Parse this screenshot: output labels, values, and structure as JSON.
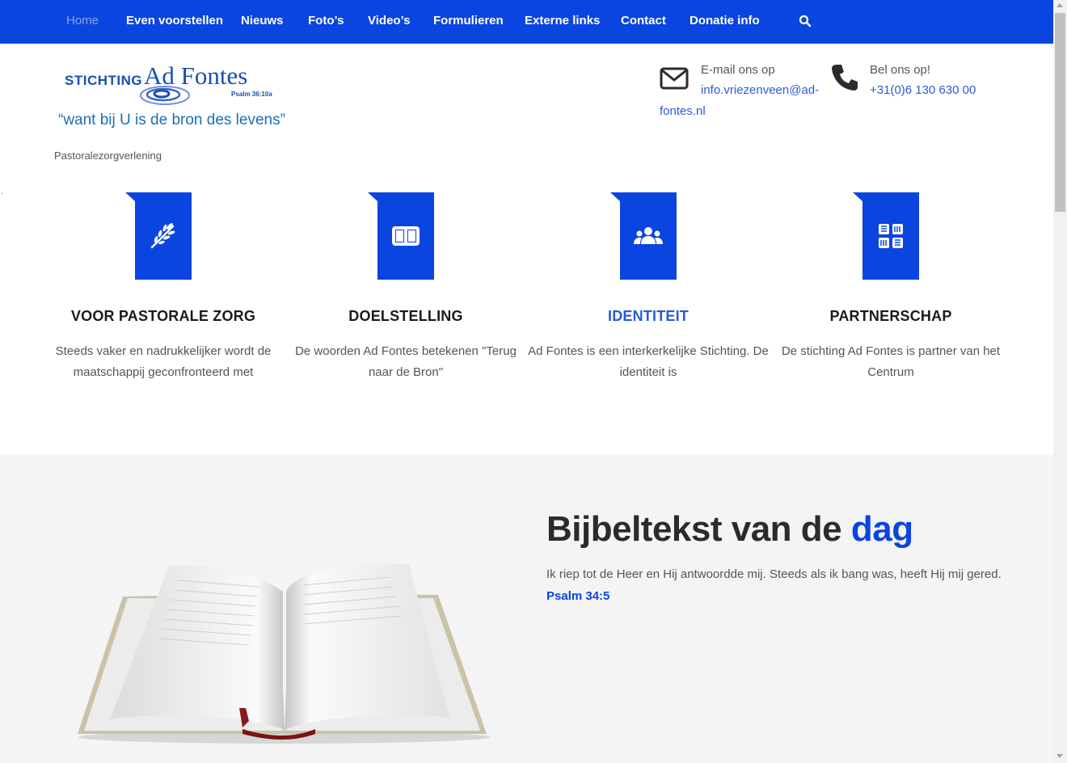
{
  "nav": {
    "items": [
      {
        "label": "Home",
        "active": true
      },
      {
        "label": "Even voorstellen"
      },
      {
        "label": "Nieuws"
      },
      {
        "label": "Foto’s"
      },
      {
        "label": "Video’s"
      },
      {
        "label": "Formulieren"
      },
      {
        "label": "Externe links"
      },
      {
        "label": "Contact"
      },
      {
        "label": "Donatie info"
      }
    ],
    "search_icon": "search-icon"
  },
  "logo": {
    "stichting": "STICHTING",
    "name": "Ad Fontes",
    "psalm": "Psalm 36:10a",
    "motto": "“want bij U is de bron des levens”"
  },
  "tagline": "Pastoralezorgverlening",
  "stray_dot": ".",
  "contact": {
    "email_label": "E-mail ons op",
    "email_value": "info.vriezenveen@ad-fontes.nl",
    "phone_label": "Bel ons op!",
    "phone_value": "+31(0)6 130 630 00"
  },
  "features": [
    {
      "icon": "olive-branch-icon",
      "title": "VOOR PASTORALE ZORG",
      "text": "Steeds vaker en nadrukkelijker wordt de maatschappij geconfronteerd met"
    },
    {
      "icon": "open-book-icon",
      "title": "DOELSTELLING",
      "text": "De woorden Ad Fontes betekenen \"Terug naar de Bron\""
    },
    {
      "icon": "people-group-icon",
      "title": "IDENTITEIT",
      "text": "Ad Fontes is een interkerkelijke Stichting. De identiteit is"
    },
    {
      "icon": "hands-together-icon",
      "title": "PARTNERSCHAP",
      "text": "De stichting Ad Fontes is partner van het Centrum"
    }
  ],
  "bible": {
    "title_main": "Bijbeltekst van de",
    "title_accent": "dag",
    "text": "Ik riep tot de Heer en Hij antwoordde mij. Steeds als ik bang was, heeft Hij mij gered.",
    "reference": "Psalm 34:5"
  },
  "colors": {
    "primary": "#0a45e0",
    "link": "#2a5bd7",
    "section_bg": "#f4f4f4"
  }
}
